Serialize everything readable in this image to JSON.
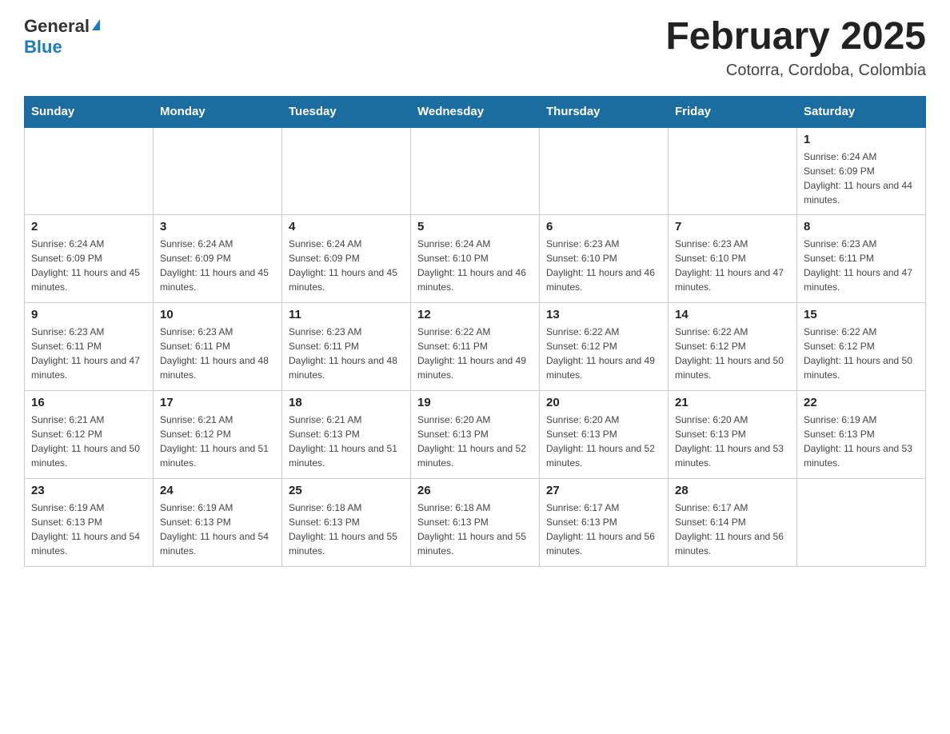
{
  "header": {
    "logo_general": "General",
    "logo_blue": "Blue",
    "month_title": "February 2025",
    "location": "Cotorra, Cordoba, Colombia"
  },
  "days_of_week": [
    "Sunday",
    "Monday",
    "Tuesday",
    "Wednesday",
    "Thursday",
    "Friday",
    "Saturday"
  ],
  "weeks": [
    [
      {
        "day": "",
        "info": ""
      },
      {
        "day": "",
        "info": ""
      },
      {
        "day": "",
        "info": ""
      },
      {
        "day": "",
        "info": ""
      },
      {
        "day": "",
        "info": ""
      },
      {
        "day": "",
        "info": ""
      },
      {
        "day": "1",
        "info": "Sunrise: 6:24 AM\nSunset: 6:09 PM\nDaylight: 11 hours and 44 minutes."
      }
    ],
    [
      {
        "day": "2",
        "info": "Sunrise: 6:24 AM\nSunset: 6:09 PM\nDaylight: 11 hours and 45 minutes."
      },
      {
        "day": "3",
        "info": "Sunrise: 6:24 AM\nSunset: 6:09 PM\nDaylight: 11 hours and 45 minutes."
      },
      {
        "day": "4",
        "info": "Sunrise: 6:24 AM\nSunset: 6:09 PM\nDaylight: 11 hours and 45 minutes."
      },
      {
        "day": "5",
        "info": "Sunrise: 6:24 AM\nSunset: 6:10 PM\nDaylight: 11 hours and 46 minutes."
      },
      {
        "day": "6",
        "info": "Sunrise: 6:23 AM\nSunset: 6:10 PM\nDaylight: 11 hours and 46 minutes."
      },
      {
        "day": "7",
        "info": "Sunrise: 6:23 AM\nSunset: 6:10 PM\nDaylight: 11 hours and 47 minutes."
      },
      {
        "day": "8",
        "info": "Sunrise: 6:23 AM\nSunset: 6:11 PM\nDaylight: 11 hours and 47 minutes."
      }
    ],
    [
      {
        "day": "9",
        "info": "Sunrise: 6:23 AM\nSunset: 6:11 PM\nDaylight: 11 hours and 47 minutes."
      },
      {
        "day": "10",
        "info": "Sunrise: 6:23 AM\nSunset: 6:11 PM\nDaylight: 11 hours and 48 minutes."
      },
      {
        "day": "11",
        "info": "Sunrise: 6:23 AM\nSunset: 6:11 PM\nDaylight: 11 hours and 48 minutes."
      },
      {
        "day": "12",
        "info": "Sunrise: 6:22 AM\nSunset: 6:11 PM\nDaylight: 11 hours and 49 minutes."
      },
      {
        "day": "13",
        "info": "Sunrise: 6:22 AM\nSunset: 6:12 PM\nDaylight: 11 hours and 49 minutes."
      },
      {
        "day": "14",
        "info": "Sunrise: 6:22 AM\nSunset: 6:12 PM\nDaylight: 11 hours and 50 minutes."
      },
      {
        "day": "15",
        "info": "Sunrise: 6:22 AM\nSunset: 6:12 PM\nDaylight: 11 hours and 50 minutes."
      }
    ],
    [
      {
        "day": "16",
        "info": "Sunrise: 6:21 AM\nSunset: 6:12 PM\nDaylight: 11 hours and 50 minutes."
      },
      {
        "day": "17",
        "info": "Sunrise: 6:21 AM\nSunset: 6:12 PM\nDaylight: 11 hours and 51 minutes."
      },
      {
        "day": "18",
        "info": "Sunrise: 6:21 AM\nSunset: 6:13 PM\nDaylight: 11 hours and 51 minutes."
      },
      {
        "day": "19",
        "info": "Sunrise: 6:20 AM\nSunset: 6:13 PM\nDaylight: 11 hours and 52 minutes."
      },
      {
        "day": "20",
        "info": "Sunrise: 6:20 AM\nSunset: 6:13 PM\nDaylight: 11 hours and 52 minutes."
      },
      {
        "day": "21",
        "info": "Sunrise: 6:20 AM\nSunset: 6:13 PM\nDaylight: 11 hours and 53 minutes."
      },
      {
        "day": "22",
        "info": "Sunrise: 6:19 AM\nSunset: 6:13 PM\nDaylight: 11 hours and 53 minutes."
      }
    ],
    [
      {
        "day": "23",
        "info": "Sunrise: 6:19 AM\nSunset: 6:13 PM\nDaylight: 11 hours and 54 minutes."
      },
      {
        "day": "24",
        "info": "Sunrise: 6:19 AM\nSunset: 6:13 PM\nDaylight: 11 hours and 54 minutes."
      },
      {
        "day": "25",
        "info": "Sunrise: 6:18 AM\nSunset: 6:13 PM\nDaylight: 11 hours and 55 minutes."
      },
      {
        "day": "26",
        "info": "Sunrise: 6:18 AM\nSunset: 6:13 PM\nDaylight: 11 hours and 55 minutes."
      },
      {
        "day": "27",
        "info": "Sunrise: 6:17 AM\nSunset: 6:13 PM\nDaylight: 11 hours and 56 minutes."
      },
      {
        "day": "28",
        "info": "Sunrise: 6:17 AM\nSunset: 6:14 PM\nDaylight: 11 hours and 56 minutes."
      },
      {
        "day": "",
        "info": ""
      }
    ]
  ]
}
